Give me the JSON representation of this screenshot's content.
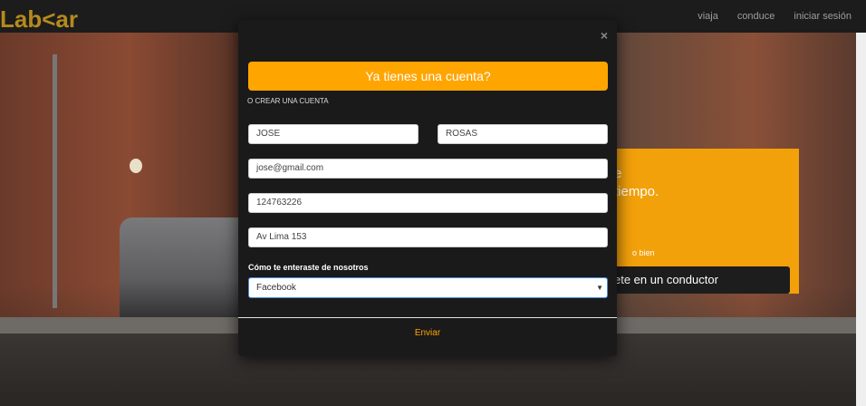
{
  "navbar": {
    "brand": "Lab<ar",
    "links": [
      "viaja",
      "conduce",
      "iniciar sesión"
    ]
  },
  "promo": {
    "line1": "e",
    "line2": "tiempo.",
    "small": "o bien",
    "button_label": "ete en un conductor"
  },
  "modal": {
    "close_icon": "×",
    "account_button": "Ya tienes una cuenta?",
    "create_label": "O CREAR UNA CUENTA",
    "first_name": "JOSE",
    "last_name": "ROSAS",
    "email": "jose@gmail.com",
    "phone": "124763226",
    "address": "Av Lima 153",
    "source_label": "Cómo te enteraste de nosotros",
    "source_selected": "Facebook",
    "submit": "Enviar"
  },
  "colors": {
    "accent": "#ffa500",
    "brand": "#b58a1e",
    "navbar_bg": "#1c1c1c",
    "modal_bg": "#1a1a1a"
  }
}
